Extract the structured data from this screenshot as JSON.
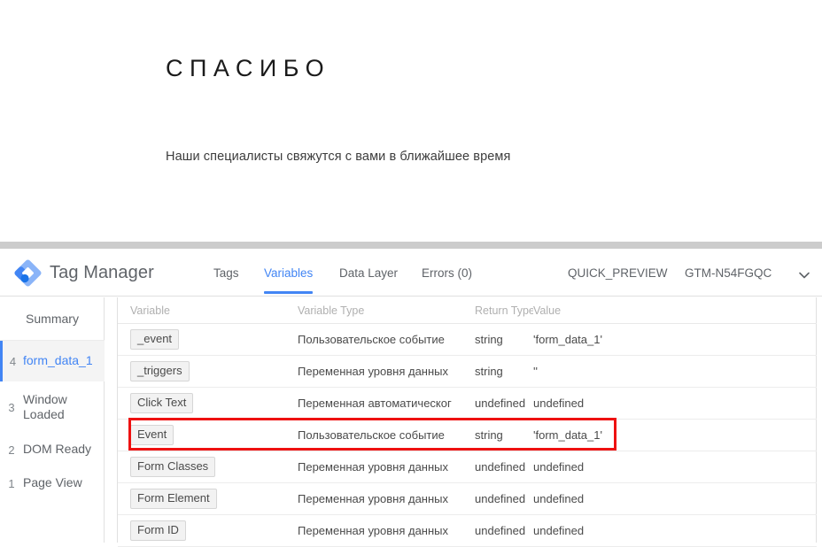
{
  "page": {
    "title": "СПАСИБО",
    "subtitle": "Наши специалисты свяжутся с вами в ближайшее время"
  },
  "gtm": {
    "brand": "Tag Manager",
    "logo_icon": "tag-manager-diamond-logo-icon",
    "chevron_icon": "chevron-down-icon",
    "colors": {
      "accent_blue": "#4285f4",
      "logo_light_blue": "#8ab4f8",
      "logo_dark_blue": "#1a73e8",
      "text_gray": "#5f6368",
      "divider_gray": "#cccccc",
      "highlight_red": "#ee1111"
    },
    "tabs": [
      {
        "label": "Tags",
        "active": false
      },
      {
        "label": "Variables",
        "active": true
      },
      {
        "label": "Data Layer",
        "active": false
      },
      {
        "label": "Errors (0)",
        "active": false
      }
    ],
    "quick_preview_label": "QUICK_PREVIEW",
    "container_id": "GTM-N54FGQC",
    "sidebar": {
      "summary_label": "Summary",
      "items": [
        {
          "num": "4",
          "label": "form_data_1",
          "selected": true
        },
        {
          "num": "3",
          "label": "Window Loaded",
          "selected": false
        },
        {
          "num": "2",
          "label": "DOM Ready",
          "selected": false
        },
        {
          "num": "1",
          "label": "Page View",
          "selected": false
        }
      ]
    },
    "table": {
      "headers": {
        "variable": "Variable",
        "variable_type": "Variable Type",
        "return_type": "Return Type",
        "value": "Value"
      },
      "rows": [
        {
          "variable": "_event",
          "variable_type": "Пользовательское событие",
          "return_type": "string",
          "value": "'form_data_1'",
          "highlighted": false
        },
        {
          "variable": "_triggers",
          "variable_type": "Переменная уровня данных",
          "return_type": "string",
          "value": "''",
          "highlighted": false
        },
        {
          "variable": "Click Text",
          "variable_type": "Переменная автоматическог",
          "return_type": "undefined",
          "value": "undefined",
          "highlighted": false
        },
        {
          "variable": "Event",
          "variable_type": "Пользовательское событие",
          "return_type": "string",
          "value": "'form_data_1'",
          "highlighted": true
        },
        {
          "variable": "Form Classes",
          "variable_type": "Переменная уровня данных",
          "return_type": "undefined",
          "value": "undefined",
          "highlighted": false
        },
        {
          "variable": "Form Element",
          "variable_type": "Переменная уровня данных",
          "return_type": "undefined",
          "value": "undefined",
          "highlighted": false
        },
        {
          "variable": "Form ID",
          "variable_type": "Переменная уровня данных",
          "return_type": "undefined",
          "value": "undefined",
          "highlighted": false
        }
      ]
    }
  }
}
